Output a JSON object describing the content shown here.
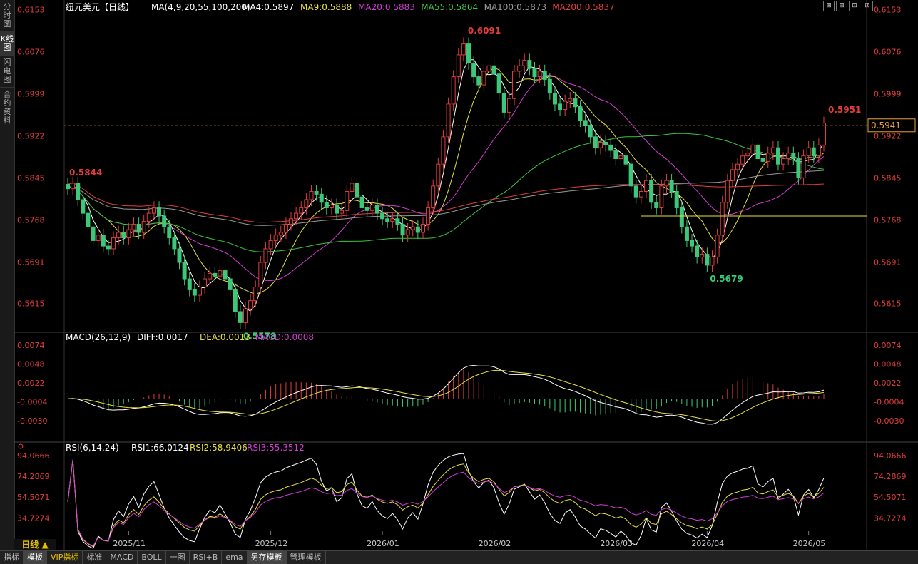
{
  "sidebar": {
    "tabs": [
      "分时图",
      "K线图",
      "闪电图",
      "合约资料"
    ],
    "active": 1
  },
  "header": {
    "title": "纽元美元【日线】",
    "ma_label": "MA(4,9,20,55,100,200)",
    "mas": [
      {
        "label": "MA4:0.5897",
        "color": "#ffffff"
      },
      {
        "label": "MA9:0.5888",
        "color": "#e8e03a"
      },
      {
        "label": "MA20:0.5883",
        "color": "#d43cd4"
      },
      {
        "label": "MA55:0.5864",
        "color": "#3cc43c"
      },
      {
        "label": "MA100:0.5873",
        "color": "#9a9a9a"
      },
      {
        "label": "MA200:0.5837",
        "color": "#e23c3c"
      }
    ]
  },
  "window_controls": [
    "⊞",
    "⊟",
    "⊡",
    "⊠"
  ],
  "price_axis": {
    "ticks": [
      "0.6153",
      "0.6076",
      "0.5999",
      "0.5922",
      "0.5845",
      "0.5768",
      "0.5691",
      "0.5615"
    ],
    "current": "0.5941"
  },
  "annotations": {
    "high": "0.6091",
    "low1": "0.5578",
    "low2": "0.5679",
    "left": "0.5844",
    "last_high": "0.5951"
  },
  "macd": {
    "label": "MACD(26,12,9)",
    "diff": "DIFF:0.0017",
    "dea": "DEA:0.0013",
    "macd": "MACD:0.0008",
    "ticks": [
      "0.0074",
      "0.0048",
      "0.0022",
      "-0.0004",
      "-0.0030"
    ]
  },
  "rsi": {
    "label": "RSI(6,14,24)",
    "r1": "RSI1:66.0124",
    "r2": "RSI2:58.9406",
    "r3": "RSI3:55.3512",
    "ticks": [
      "94.0666",
      "74.2869",
      "54.5071",
      "34.7274"
    ]
  },
  "dates": [
    "2025/11",
    "2025/12",
    "2026/01",
    "2026/02",
    "2026/03",
    "2026/04",
    "2026/05"
  ],
  "period": "日线 ▲",
  "bottom_tabs": [
    "指标",
    "模板",
    "VIP指标",
    "标准",
    "MACD",
    "BOLL",
    "一图",
    "RSI+B",
    "ema",
    "另存模板",
    "管理模板"
  ],
  "chart_data": {
    "type": "candlestick",
    "symbol": "纽元美元",
    "y_range": [
      0.557,
      0.616
    ],
    "closes": [
      0.5825,
      0.5835,
      0.5805,
      0.578,
      0.5755,
      0.573,
      0.574,
      0.572,
      0.5715,
      0.5735,
      0.5745,
      0.5735,
      0.575,
      0.576,
      0.5745,
      0.5765,
      0.578,
      0.579,
      0.5775,
      0.5755,
      0.5735,
      0.5715,
      0.569,
      0.566,
      0.564,
      0.563,
      0.5645,
      0.566,
      0.567,
      0.5665,
      0.5675,
      0.566,
      0.564,
      0.56,
      0.558,
      0.5605,
      0.562,
      0.5645,
      0.569,
      0.5715,
      0.573,
      0.574,
      0.5745,
      0.576,
      0.577,
      0.578,
      0.579,
      0.5805,
      0.582,
      0.5815,
      0.58,
      0.579,
      0.5795,
      0.578,
      0.5785,
      0.582,
      0.5835,
      0.581,
      0.579,
      0.5785,
      0.5795,
      0.578,
      0.577,
      0.5765,
      0.577,
      0.576,
      0.574,
      0.575,
      0.5755,
      0.5745,
      0.576,
      0.579,
      0.583,
      0.587,
      0.592,
      0.598,
      0.603,
      0.607,
      0.609,
      0.6055,
      0.603,
      0.6015,
      0.604,
      0.605,
      0.6035,
      0.6,
      0.5965,
      0.599,
      0.604,
      0.605,
      0.606,
      0.6045,
      0.603,
      0.604,
      0.6025,
      0.6,
      0.598,
      0.597,
      0.5985,
      0.599,
      0.5975,
      0.595,
      0.594,
      0.592,
      0.59,
      0.591,
      0.5905,
      0.5895,
      0.588,
      0.5885,
      0.587,
      0.583,
      0.581,
      0.582,
      0.584,
      0.58,
      0.579,
      0.583,
      0.584,
      0.582,
      0.579,
      0.5755,
      0.573,
      0.572,
      0.57,
      0.5705,
      0.5685,
      0.57,
      0.574,
      0.58,
      0.584,
      0.586,
      0.587,
      0.5885,
      0.589,
      0.5905,
      0.588,
      0.5875,
      0.589,
      0.59,
      0.587,
      0.588,
      0.589,
      0.588,
      0.5845,
      0.5885,
      0.59,
      0.5885,
      0.5905,
      0.5945
    ],
    "annotations": [
      {
        "label": "0.6091",
        "idx": 78,
        "type": "high"
      },
      {
        "label": "0.5578",
        "idx": 34,
        "type": "low"
      },
      {
        "label": "0.5679",
        "idx": 126,
        "type": "low"
      },
      {
        "label": "0.5844",
        "idx": 0,
        "type": "left"
      },
      {
        "label": "0.5951",
        "idx": 149,
        "type": "high"
      }
    ],
    "hline": 0.5775,
    "current_price_line": 0.5941
  }
}
